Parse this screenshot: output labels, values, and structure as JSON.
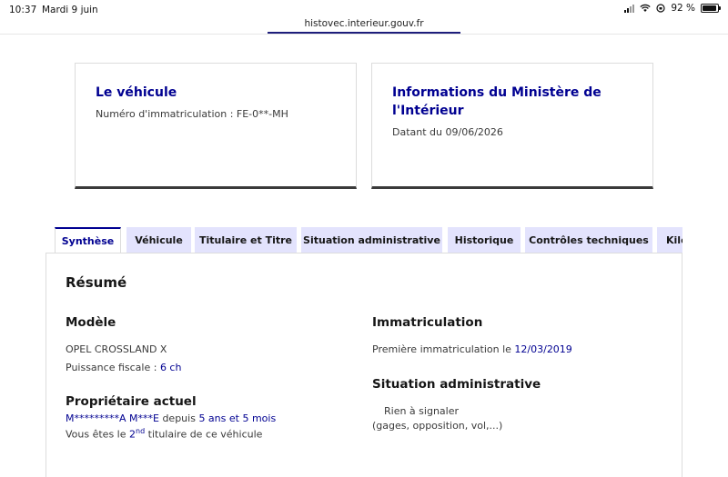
{
  "status_bar": {
    "time": "10:37",
    "date": "Mardi 9 juin",
    "url": "histovec.interieur.gouv.fr",
    "battery": "92 %",
    "battery_level": 0.92
  },
  "card_vehicle": {
    "title": "Le véhicule",
    "plate_label": "Numéro d'immatriculation : FE-0**-MH"
  },
  "card_ministry": {
    "title_line1": "Informations du Ministère de",
    "title_line2": "l'Intérieur",
    "date_label": "Datant du 09/06/2026"
  },
  "tabs": [
    {
      "label": "Synthèse",
      "active": true
    },
    {
      "label": "Véhicule",
      "active": false
    },
    {
      "label": "Titulaire et Titre",
      "active": false
    },
    {
      "label": "Situation administrative",
      "active": false
    },
    {
      "label": "Historique",
      "active": false
    },
    {
      "label": "Contrôles techniques",
      "active": false
    },
    {
      "label": "Kilo",
      "active": false
    }
  ],
  "summary": {
    "heading": "Résumé",
    "model": {
      "heading": "Modèle",
      "name": "OPEL CROSSLAND X",
      "power_label": "Puissance fiscale : ",
      "power_value": "6 ch"
    },
    "owner": {
      "heading": "Propriétaire actuel",
      "name": "M*********A M***E",
      "since_label": " depuis ",
      "since_value": "5 ans et 5 mois",
      "rank_prefix": "Vous êtes le ",
      "rank_num": "2",
      "rank_sup": "nd",
      "rank_suffix": " titulaire de ce véhicule"
    },
    "registration": {
      "heading": "Immatriculation",
      "first_label": "Première immatriculation le ",
      "first_value": "12/03/2019"
    },
    "admin": {
      "heading": "Situation administrative",
      "status": "Rien à signaler",
      "details": "(gages, opposition, vol,...)"
    }
  },
  "colors": {
    "accent": "#000091",
    "tab_bg": "#e3e3fd",
    "card_border_bottom": "#3a3a3a"
  }
}
